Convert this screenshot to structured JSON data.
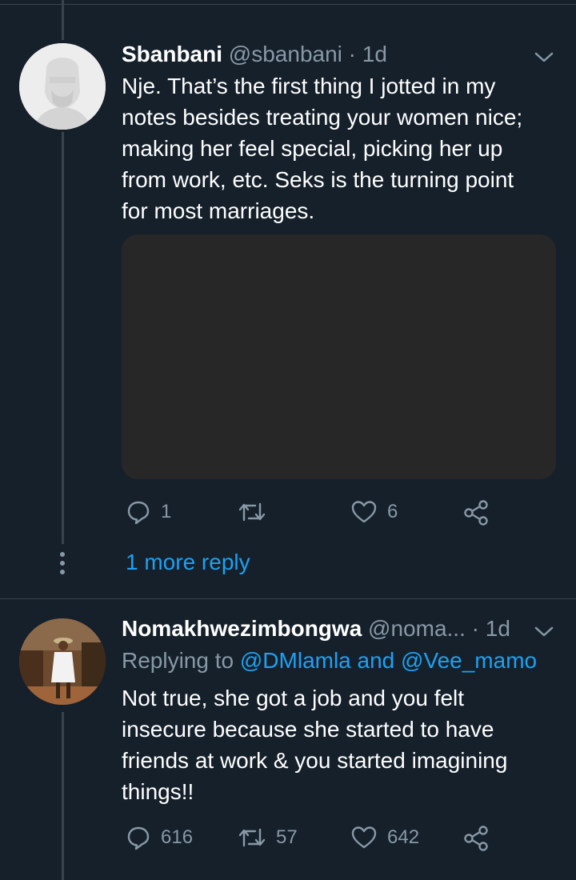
{
  "colors": {
    "background": "#15202b",
    "text": "#ffffff",
    "secondary": "#8899a6",
    "accent": "#1da1f2",
    "divider": "#38444d"
  },
  "tweets": [
    {
      "name": "Sbanbani",
      "handle": "@sbanbani",
      "separator": "·",
      "time": "1d",
      "text_lines": [
        "Nje. That’s the first thing I jotted in my",
        "notes besides treating your women nice;",
        "making her feel special, picking her up",
        "from work, etc. Seks is the turning point",
        "for most marriages."
      ],
      "has_media": true,
      "actions": {
        "reply_icon": "reply-icon",
        "reply_count": "1",
        "retweet_icon": "retweet-icon",
        "retweet_count": "",
        "like_icon": "heart-icon",
        "like_count": "6",
        "share_icon": "share-icon"
      },
      "more_replies": "1 more reply"
    },
    {
      "name": "Nomakhwezimbongwa",
      "handle": "@noma...",
      "separator": "·",
      "time": "1d",
      "replying_prefix": "Replying to",
      "replying_users": "@DMlamla and @Vee_mamo",
      "text_lines": [
        "Not true, she got a job and you felt",
        "insecure because she started to have",
        "friends at work & you started imagining",
        "things!!"
      ],
      "actions": {
        "reply_icon": "reply-icon",
        "reply_count": "616",
        "retweet_icon": "retweet-icon",
        "retweet_count": "57",
        "like_icon": "heart-icon",
        "like_count": "642",
        "share_icon": "share-icon"
      }
    }
  ]
}
